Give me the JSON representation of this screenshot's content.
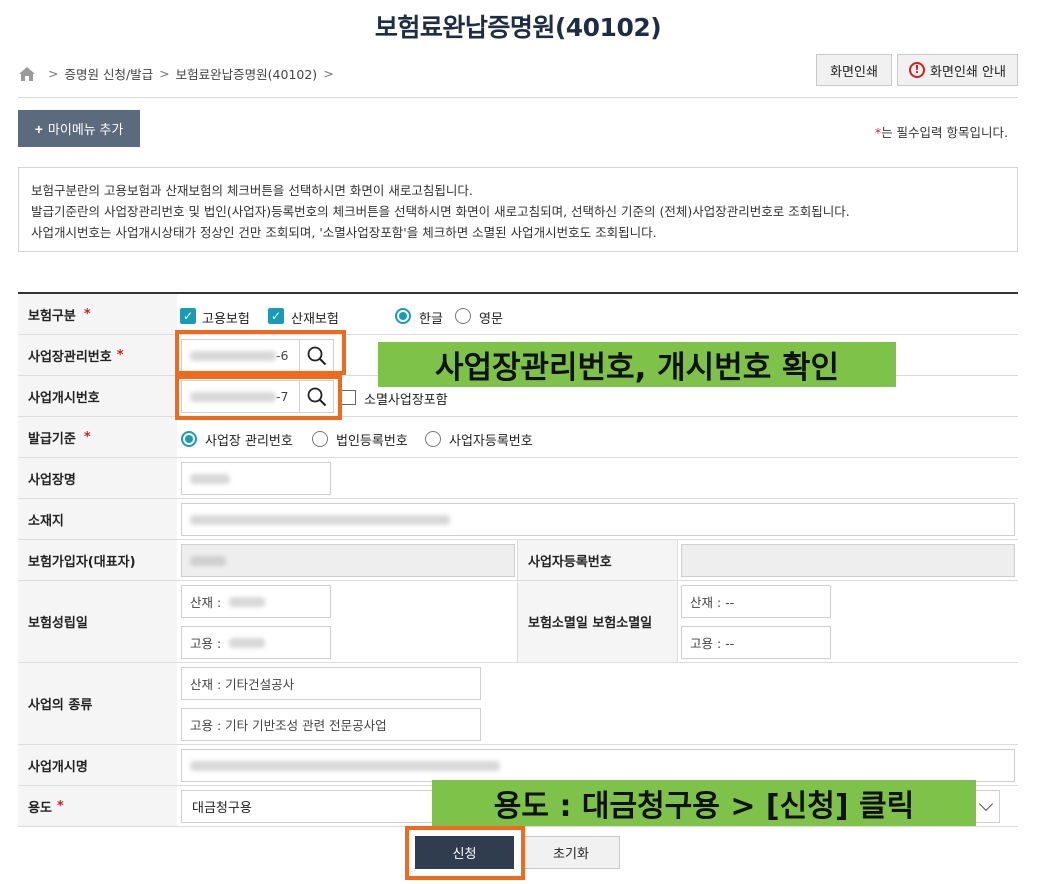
{
  "page": {
    "title": "보험료완납증명원(40102)"
  },
  "breadcrumb": {
    "items": [
      "증명원 신청/발급",
      "보험료완납증명원(40102)"
    ],
    "separator": ">"
  },
  "top_buttons": {
    "print": "화면인쇄",
    "print_guide": "화면인쇄 안내"
  },
  "mymenu": {
    "label": "마이메뉴 추가",
    "icon": "plus-icon"
  },
  "required_note": {
    "star": "*",
    "text": "는 필수입력 항목입니다."
  },
  "info": {
    "lines": [
      "보험구분란의 고용보험과 산재보험의 체크버튼을 선택하시면 화면이 새로고침됩니다.",
      "발급기준란의 사업장관리번호 및 법인(사업자)등록번호의 체크버튼을 선택하시면 화면이 새로고침되며, 선택하신 기준의 (전체)사업장관리번호로 조회됩니다.",
      "사업개시번호는 사업개시상태가 정상인 건만 조회되며, '소멸사업장포함'을 체크하면 소멸된 사업개시번호도 조회됩니다."
    ]
  },
  "form": {
    "insurance_type": {
      "label": "보험구분",
      "required": "*",
      "employment": "고용보험",
      "accident": "산재보험",
      "employment_checked": true,
      "accident_checked": true,
      "lang_korean": "한글",
      "lang_english": "영문",
      "lang_selected": "한글"
    },
    "biz_mgmt_no": {
      "label": "사업장관리번호",
      "required": "*",
      "value_suffix": "-6"
    },
    "biz_start_no": {
      "label": "사업개시번호",
      "value_suffix": "-7",
      "include_closed": "소멸사업장포함",
      "include_closed_checked": false
    },
    "issue_basis": {
      "label": "발급기준",
      "required": "*",
      "options": [
        "사업장 관리번호",
        "법인등록번호",
        "사업자등록번호"
      ],
      "selected": "사업장 관리번호"
    },
    "biz_name": {
      "label": "사업장명"
    },
    "address": {
      "label": "소재지"
    },
    "insured": {
      "label": "보험가입자(대표자)"
    },
    "biz_reg_no": {
      "label": "사업자등록번호"
    },
    "established": {
      "label": "보험성립일",
      "accident_prefix": "산재 :",
      "employment_prefix": "고용 :"
    },
    "closed": {
      "label": "보험소멸일 보험소멸일",
      "accident": "산재 : --",
      "employment": "고용 : --"
    },
    "biz_type": {
      "label": "사업의 종류",
      "accident": "산재 : 기타건설공사",
      "employment": "고용 : 기타 기반조성 관련 전문공사업"
    },
    "biz_start_name": {
      "label": "사업개시명"
    },
    "purpose": {
      "label": "용도",
      "required": "*",
      "selected": "대금청구용"
    }
  },
  "actions": {
    "apply": "신청",
    "reset": "초기화"
  },
  "callouts": {
    "check_numbers": "사업장관리번호, 개시번호 확인",
    "purpose_click": "용도 : 대금청구용 > [신청] 클릭"
  },
  "colors": {
    "accent_teal": "#1a9bb5",
    "highlight_orange": "#f06a1d",
    "callout_green": "#7fc24a",
    "apply_button": "#2f3d4f"
  }
}
